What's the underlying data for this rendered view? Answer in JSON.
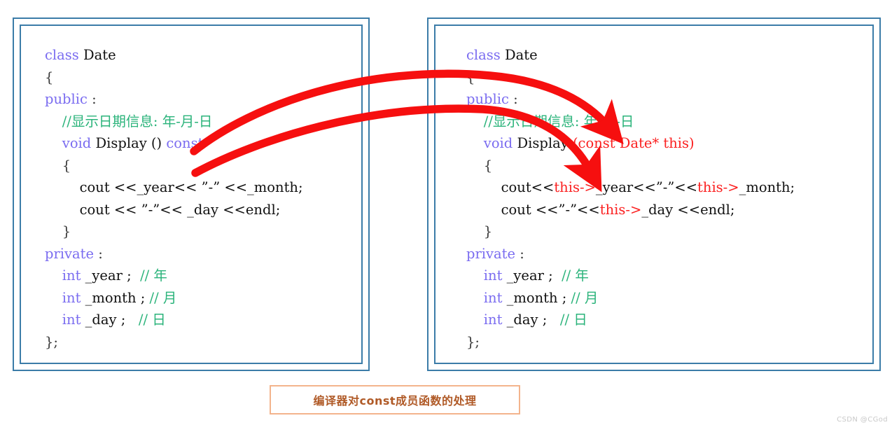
{
  "diagram": {
    "title_caption": "编译器对const成员函数的处理",
    "watermark": "CSDN @CGod",
    "accent_border_color": "#3b7ca8",
    "arrow_color": "#f60f0f",
    "caption_border_color": "#f3b48c",
    "caption_text_color": "#b05a27",
    "keyword_color": "#7a6cf0",
    "comment_color": "#2ab37a",
    "injected_color": "#fb2020"
  },
  "left_panel": {
    "name": "original const member function",
    "lines": [
      {
        "indent": 0,
        "tokens": [
          {
            "t": "class ",
            "c": "kw"
          },
          {
            "t": "Date",
            "c": "id"
          }
        ]
      },
      {
        "indent": 0,
        "tokens": [
          {
            "t": "{",
            "c": "punc"
          }
        ]
      },
      {
        "indent": 0,
        "tokens": [
          {
            "t": "public",
            "c": "kw"
          },
          {
            "t": " :",
            "c": "punc"
          }
        ]
      },
      {
        "indent": 1,
        "tokens": [
          {
            "t": "//显示日期信息: 年-月-日",
            "c": "cmt"
          }
        ]
      },
      {
        "indent": 1,
        "tokens": [
          {
            "t": "void ",
            "c": "kw"
          },
          {
            "t": "Display () ",
            "c": "id"
          },
          {
            "t": "const",
            "c": "kw"
          }
        ]
      },
      {
        "indent": 1,
        "tokens": [
          {
            "t": "{",
            "c": "punc"
          }
        ]
      },
      {
        "indent": 2,
        "tokens": [
          {
            "t": "cout <<_year<< ”-” <<_month;",
            "c": "id"
          }
        ]
      },
      {
        "indent": 2,
        "tokens": [
          {
            "t": "cout << ”-”<< _day <<endl;",
            "c": "id"
          }
        ]
      },
      {
        "indent": 1,
        "tokens": [
          {
            "t": "}",
            "c": "punc"
          }
        ]
      },
      {
        "indent": 0,
        "tokens": [
          {
            "t": "private",
            "c": "kw"
          },
          {
            "t": " :",
            "c": "punc"
          }
        ]
      },
      {
        "indent": 1,
        "tokens": [
          {
            "t": "int ",
            "c": "kw"
          },
          {
            "t": "_year ;  ",
            "c": "id"
          },
          {
            "t": "// 年",
            "c": "cmt"
          }
        ]
      },
      {
        "indent": 1,
        "tokens": [
          {
            "t": "int ",
            "c": "kw"
          },
          {
            "t": "_month ; ",
            "c": "id"
          },
          {
            "t": "// 月",
            "c": "cmt"
          }
        ]
      },
      {
        "indent": 1,
        "tokens": [
          {
            "t": "int ",
            "c": "kw"
          },
          {
            "t": "_day ;   ",
            "c": "id"
          },
          {
            "t": "// 日",
            "c": "cmt"
          }
        ]
      },
      {
        "indent": 0,
        "tokens": [
          {
            "t": "};",
            "c": "punc"
          }
        ]
      }
    ]
  },
  "right_panel": {
    "name": "compiler-expanded const member function with this pointer",
    "lines": [
      {
        "indent": 0,
        "tokens": [
          {
            "t": "class ",
            "c": "kw"
          },
          {
            "t": "Date",
            "c": "id"
          }
        ]
      },
      {
        "indent": 0,
        "tokens": [
          {
            "t": "{",
            "c": "punc"
          }
        ]
      },
      {
        "indent": 0,
        "tokens": [
          {
            "t": "public",
            "c": "kw"
          },
          {
            "t": " :",
            "c": "punc"
          }
        ]
      },
      {
        "indent": 1,
        "tokens": [
          {
            "t": "//显示日期信息: 年-月-日",
            "c": "cmt"
          }
        ]
      },
      {
        "indent": 1,
        "tokens": [
          {
            "t": "void ",
            "c": "kw"
          },
          {
            "t": "Display ",
            "c": "id"
          },
          {
            "t": "(const Date* this)",
            "c": "red"
          }
        ]
      },
      {
        "indent": 1,
        "tokens": [
          {
            "t": "{",
            "c": "punc"
          }
        ]
      },
      {
        "indent": 2,
        "tokens": [
          {
            "t": "cout<<",
            "c": "id"
          },
          {
            "t": "this->",
            "c": "red"
          },
          {
            "t": "_year<<”-”<<",
            "c": "id"
          },
          {
            "t": "this->",
            "c": "red"
          },
          {
            "t": "_month;",
            "c": "id"
          }
        ]
      },
      {
        "indent": 2,
        "tokens": [
          {
            "t": "cout <<”-”<<",
            "c": "id"
          },
          {
            "t": "this->",
            "c": "red"
          },
          {
            "t": "_day <<endl;",
            "c": "id"
          }
        ]
      },
      {
        "indent": 1,
        "tokens": [
          {
            "t": "}",
            "c": "punc"
          }
        ]
      },
      {
        "indent": 0,
        "tokens": [
          {
            "t": "private",
            "c": "kw"
          },
          {
            "t": " :",
            "c": "punc"
          }
        ]
      },
      {
        "indent": 1,
        "tokens": [
          {
            "t": "int ",
            "c": "kw"
          },
          {
            "t": "_year ;  ",
            "c": "id"
          },
          {
            "t": "// 年",
            "c": "cmt"
          }
        ]
      },
      {
        "indent": 1,
        "tokens": [
          {
            "t": "int ",
            "c": "kw"
          },
          {
            "t": "_month ; ",
            "c": "id"
          },
          {
            "t": "// 月",
            "c": "cmt"
          }
        ]
      },
      {
        "indent": 1,
        "tokens": [
          {
            "t": "int ",
            "c": "kw"
          },
          {
            "t": "_day ;   ",
            "c": "id"
          },
          {
            "t": "// 日",
            "c": "cmt"
          }
        ]
      },
      {
        "indent": 0,
        "tokens": [
          {
            "t": "};",
            "c": "punc"
          }
        ]
      }
    ]
  },
  "arrows": [
    {
      "name": "arrow-const-to-this-param",
      "label": ""
    },
    {
      "name": "arrow-const-to-this-usage",
      "label": ""
    }
  ]
}
